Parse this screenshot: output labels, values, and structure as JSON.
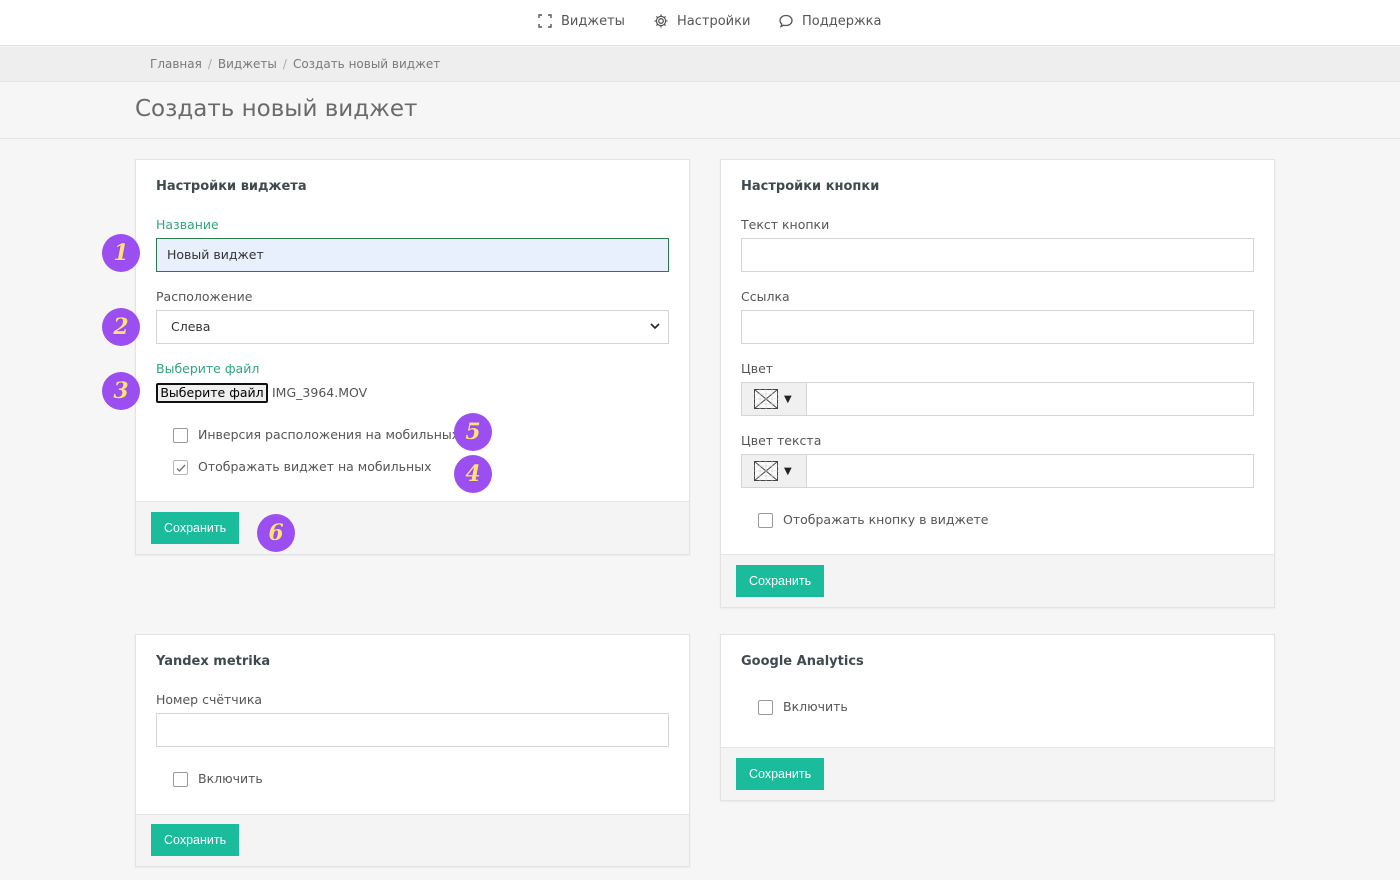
{
  "topnav": {
    "items": [
      {
        "label": "Виджеты",
        "icon": "expand-icon"
      },
      {
        "label": "Настройки",
        "icon": "gear-icon"
      },
      {
        "label": "Поддержка",
        "icon": "chat-bubble-icon"
      }
    ]
  },
  "breadcrumb": [
    "Главная",
    "Виджеты",
    "Создать новый виджет"
  ],
  "page_title": "Создать новый виджет",
  "widget_settings": {
    "title": "Настройки виджета",
    "name_label": "Название",
    "name_value": "Новый виджет",
    "position_label": "Расположение",
    "position_value": "Слева",
    "file_label": "Выберите файл",
    "file_button": "Выберите файл",
    "file_name": "IMG_3964.MOV",
    "invert_label": "Инверсия расположения на мобильных",
    "invert_checked": false,
    "mobile_label": "Отображать виджет на мобильных",
    "mobile_checked": true,
    "save": "Сохранить"
  },
  "button_settings": {
    "title": "Настройки кнопки",
    "text_label": "Текст кнопки",
    "text_value": "",
    "link_label": "Ссылка",
    "link_value": "",
    "color_label": "Цвет",
    "color_value": "",
    "text_color_label": "Цвет текста",
    "text_color_value": "",
    "show_label": "Отображать кнопку в виджете",
    "show_checked": false,
    "save": "Сохранить"
  },
  "yandex": {
    "title": "Yandex metrika",
    "counter_label": "Номер счётчика",
    "counter_value": "",
    "enable_label": "Включить",
    "enable_checked": false,
    "save": "Сохранить"
  },
  "google": {
    "title": "Google Analytics",
    "enable_label": "Включить",
    "enable_checked": false,
    "save": "Сохранить"
  },
  "badges": [
    "1",
    "2",
    "3",
    "4",
    "5",
    "6"
  ],
  "colors": {
    "accent": "#1abc9c",
    "label_green": "#2fa67c",
    "badge_bg": "#9b4ff0",
    "badge_text": "#ffe17a"
  }
}
